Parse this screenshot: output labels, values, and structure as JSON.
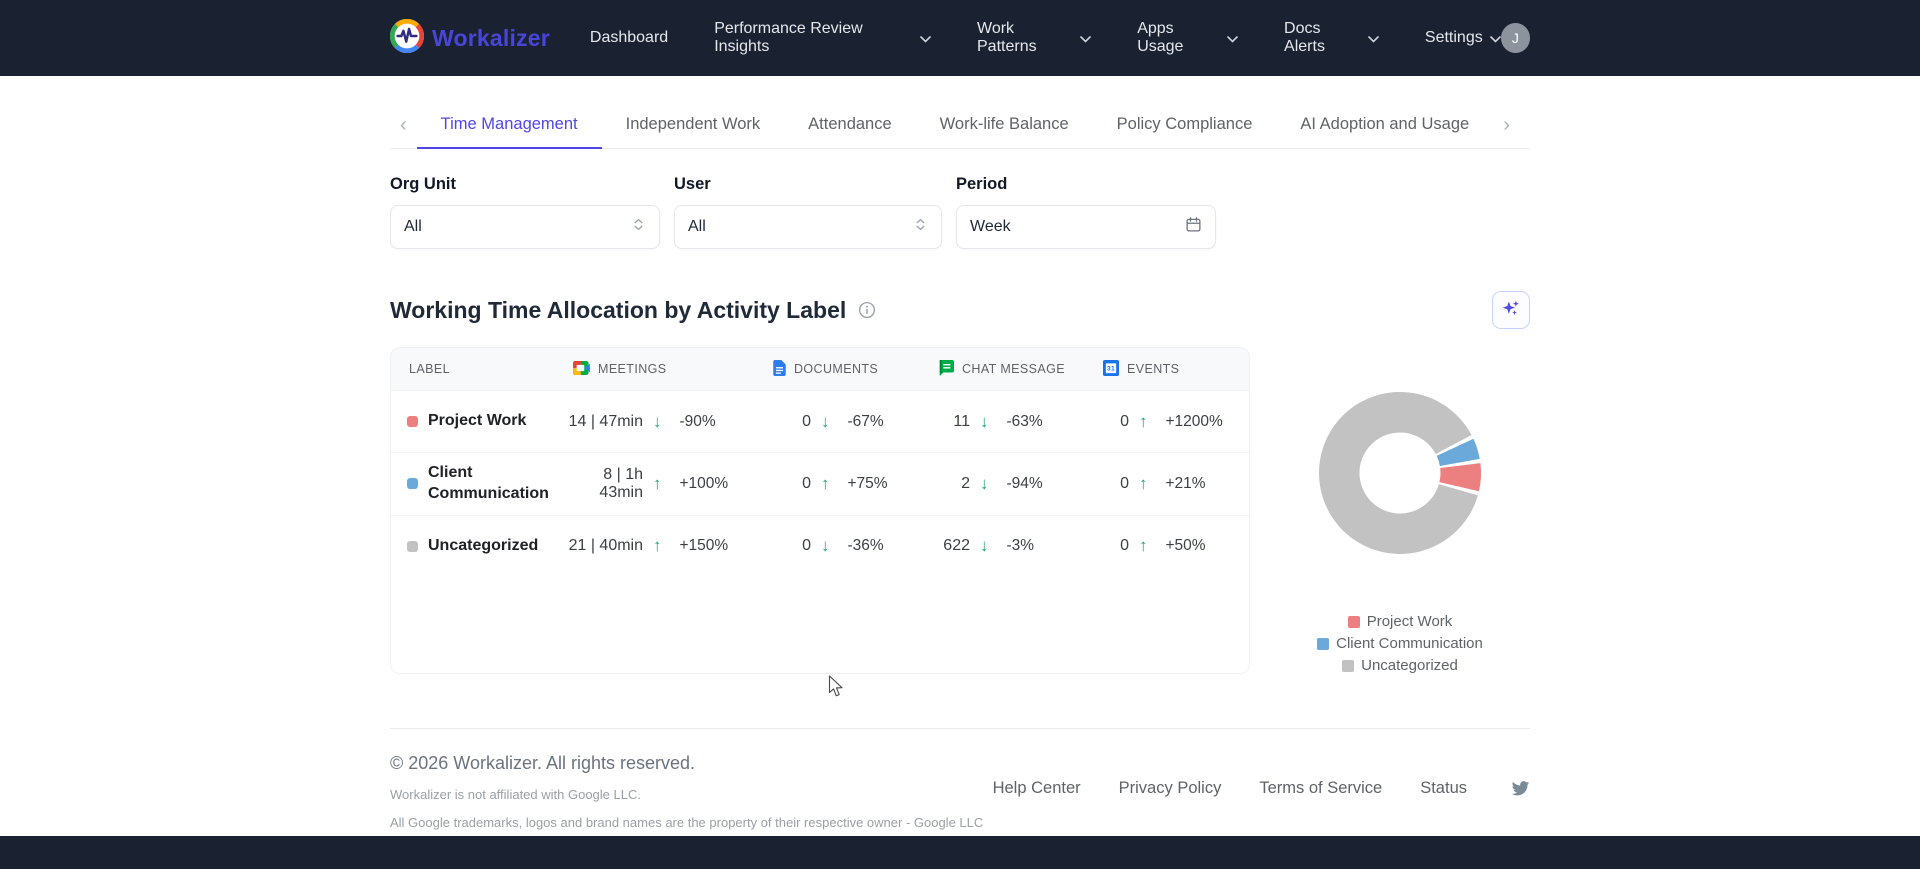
{
  "brand": {
    "name": "Workalizer"
  },
  "navbar": {
    "items": [
      {
        "label": "Dashboard",
        "has_dropdown": false
      },
      {
        "label": "Performance Review Insights",
        "has_dropdown": true
      },
      {
        "label": "Work Patterns",
        "has_dropdown": true
      },
      {
        "label": "Apps Usage",
        "has_dropdown": true
      },
      {
        "label": "Docs Alerts",
        "has_dropdown": true
      },
      {
        "label": "Settings",
        "has_dropdown": true
      }
    ],
    "avatar_initial": "J"
  },
  "tabs": {
    "active": "Time Management",
    "items": [
      {
        "label": "Time Management"
      },
      {
        "label": "Independent Work"
      },
      {
        "label": "Attendance"
      },
      {
        "label": "Work-life Balance"
      },
      {
        "label": "Policy Compliance"
      },
      {
        "label": "AI Adoption and Usage"
      }
    ]
  },
  "filters": {
    "org_unit": {
      "label": "Org Unit",
      "value": "All"
    },
    "user": {
      "label": "User",
      "value": "All"
    },
    "period": {
      "label": "Period",
      "value": "Week"
    }
  },
  "section": {
    "title": "Working Time Allocation by Activity Label"
  },
  "table": {
    "columns": [
      {
        "label": "LABEL",
        "icon": ""
      },
      {
        "label": "MEETINGS",
        "icon": "google-meet-icon"
      },
      {
        "label": "DOCUMENTS",
        "icon": "google-docs-icon"
      },
      {
        "label": "CHAT MESSAGE",
        "icon": "google-chat-icon"
      },
      {
        "label": "EVENTS",
        "icon": "google-calendar-icon"
      }
    ],
    "rows": [
      {
        "label": "Project Work",
        "color": "#ec8080",
        "meetings": {
          "value": "14 | 47min",
          "trend": "down",
          "glyph": "↓",
          "pct": "-90%"
        },
        "documents": {
          "value": "0",
          "trend": "down",
          "glyph": "↓",
          "pct": "-67%"
        },
        "chat": {
          "value": "11",
          "trend": "down",
          "glyph": "↓",
          "pct": "-63%"
        },
        "events": {
          "value": "0",
          "trend": "up",
          "glyph": "↑",
          "pct": "+1200%"
        }
      },
      {
        "label": "Client Communication",
        "color": "#6aa9d9",
        "meetings": {
          "value": "8 | 1h 43min",
          "trend": "up",
          "glyph": "↑",
          "pct": "+100%"
        },
        "documents": {
          "value": "0",
          "trend": "up",
          "glyph": "↑",
          "pct": "+75%"
        },
        "chat": {
          "value": "2",
          "trend": "down",
          "glyph": "↓",
          "pct": "-94%"
        },
        "events": {
          "value": "0",
          "trend": "up",
          "glyph": "↑",
          "pct": "+21%"
        }
      },
      {
        "label": "Uncategorized",
        "color": "#c2c2c2",
        "meetings": {
          "value": "21 | 40min",
          "trend": "up",
          "glyph": "↑",
          "pct": "+150%"
        },
        "documents": {
          "value": "0",
          "trend": "down",
          "glyph": "↓",
          "pct": "-36%"
        },
        "chat": {
          "value": "622",
          "trend": "down",
          "glyph": "↓",
          "pct": "-3%"
        },
        "events": {
          "value": "0",
          "trend": "up",
          "glyph": "↑",
          "pct": "+50%"
        }
      }
    ]
  },
  "chart_data": {
    "type": "pie",
    "donut": true,
    "title": "Working Time Allocation by Activity Label",
    "labels": [
      "Project Work",
      "Client Communication",
      "Uncategorized"
    ],
    "values_percent": [
      4,
      2,
      94
    ],
    "colors": [
      "#ec8080",
      "#6aa9d9",
      "#c2c2c2"
    ],
    "legend_position": "bottom"
  },
  "footer": {
    "copyright": "© 2026 Workalizer. All rights reserved.",
    "disclaimer1": "Workalizer is not affiliated with Google LLC.",
    "disclaimer2": "All Google trademarks, logos and brand names are the property of their respective owner - Google LLC",
    "links": [
      {
        "label": "Help Center"
      },
      {
        "label": "Privacy Policy"
      },
      {
        "label": "Terms of Service"
      },
      {
        "label": "Status"
      }
    ]
  },
  "colors": {
    "accent": "#4f46e5",
    "trend_green": "#26a46f",
    "navbar_bg": "#1a2232"
  }
}
